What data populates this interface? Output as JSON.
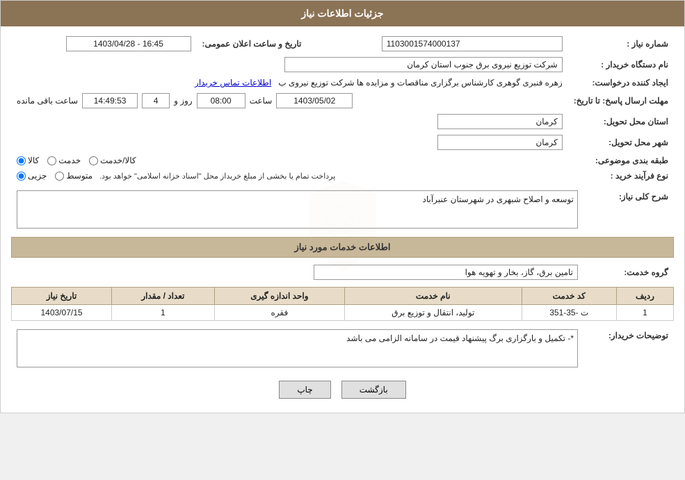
{
  "header": {
    "title": "جزئیات اطلاعات نیاز"
  },
  "fields": {
    "shomara_niaz_label": "شماره نیاز :",
    "shomara_niaz_value": "1103001574000137",
    "nam_dastgah_label": "نام دستگاه خریدار :",
    "nam_dastgah_value": "شرکت توزیع نیروی برق جنوب استان کرمان",
    "ijad_konande_label": "ایجاد کننده درخواست:",
    "ijad_konande_value": "زهره فنبری گوهری کارشناس برگزاری مناقصات و مزایده ها شرکت توزیع نیروی ب",
    "mohlat_label": "مهلت ارسال پاسخ: تا تاریخ:",
    "mohlat_date": "1403/05/02",
    "mohlat_saat_label": "ساعت",
    "mohlat_saat": "08:00",
    "mohlat_rooz_label": "روز و",
    "mohlat_rooz": "4",
    "mohlat_baqi": "14:49:53",
    "mohlat_baqi_label": "ساعت باقی مانده",
    "ostan_tahvil_label": "استان محل تحویل:",
    "ostan_tahvil_value": "کرمان",
    "shahr_tahvil_label": "شهر محل تحویل:",
    "shahr_tahvil_value": "کرمان",
    "tabaqe_label": "طبقه بندی موضوعی:",
    "tabaqe_options": [
      "کالا",
      "خدمت",
      "کالا/خدمت"
    ],
    "tabaqe_selected": "کالا",
    "nooe_farayand_label": "نوع فرآیند خرید :",
    "nooe_options": [
      "جزیی",
      "متوسط"
    ],
    "nooe_note": "پرداخت تمام یا بخشی از مبلغ خریداز محل \"اسناد خزانه اسلامی\" خواهد بود.",
    "tarikh_saat_label": "تاریخ و ساعت اعلان عمومی:",
    "tarikh_saat_value": "1403/04/28 - 16:45",
    "ettelaat_tamas_label": "اطلاعات تماس خریدار",
    "sharh_label": "شرح کلی نیاز:",
    "sharh_value": "توسعه و اصلاح شبهری در شهرستان عنبرآباد",
    "section2_header": "اطلاعات خدمات مورد نیاز",
    "gorooh_label": "گروه خدمت:",
    "gorooh_value": "تامین برق، گاز، بخار و تهویه هوا",
    "table_headers": [
      "ردیف",
      "کد خدمت",
      "نام خدمت",
      "واحد اندازه گیری",
      "تعداد / مقدار",
      "تاریخ نیاز"
    ],
    "table_rows": [
      {
        "radif": "1",
        "kod_khedmat": "ت -35-351",
        "name_khedmat": "تولید، انتقال و توزیع برق",
        "vahed": "فقره",
        "tedad": "1",
        "tarikh": "1403/07/15"
      }
    ],
    "tosiyat_label": "توضیحات خریدار:",
    "tosiyat_value": "*- تکمیل و بارگزاری برگ پیشنهاد قیمت در سامانه الزامی می باشد",
    "btn_print": "چاپ",
    "btn_back": "بازگشت"
  }
}
